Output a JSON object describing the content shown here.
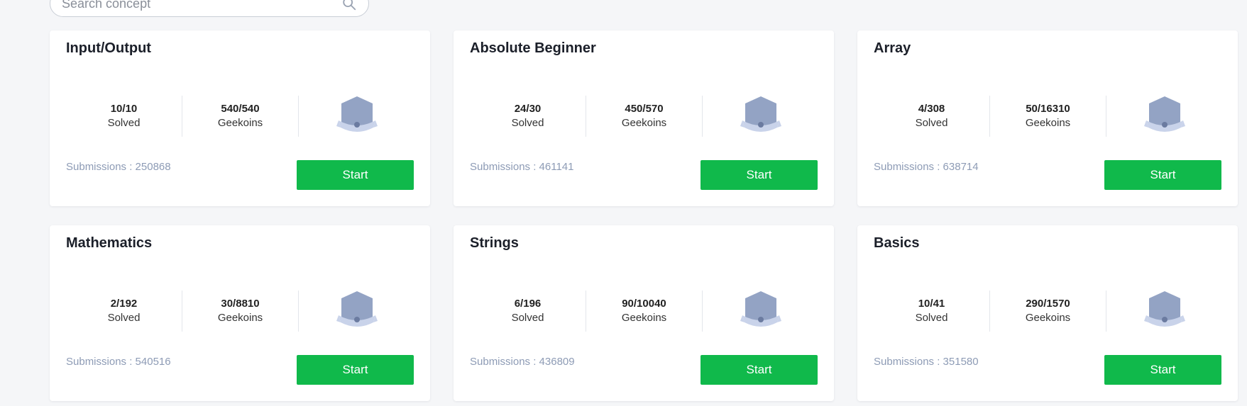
{
  "search": {
    "placeholder": "Search concept",
    "value": ""
  },
  "labels": {
    "solved": "Solved",
    "geekoins": "Geekoins",
    "start": "Start",
    "submissions_prefix": "Submissions : "
  },
  "colors": {
    "start_button": "#10b94b",
    "submissions_text": "#8d9bb5",
    "badge": "#93a3c4",
    "background": "#f5f6f8"
  },
  "cards": [
    {
      "title": "Input/Output",
      "solved": "10/10",
      "geekoins": "540/540",
      "submissions": "Submissions : 250868"
    },
    {
      "title": "Absolute Beginner",
      "solved": "24/30",
      "geekoins": "450/570",
      "submissions": "Submissions : 461141"
    },
    {
      "title": "Array",
      "solved": "4/308",
      "geekoins": "50/16310",
      "submissions": "Submissions : 638714"
    },
    {
      "title": "Mathematics",
      "solved": "2/192",
      "geekoins": "30/8810",
      "submissions": "Submissions : 540516"
    },
    {
      "title": "Strings",
      "solved": "6/196",
      "geekoins": "90/10040",
      "submissions": "Submissions : 436809"
    },
    {
      "title": "Basics",
      "solved": "10/41",
      "geekoins": "290/1570",
      "submissions": "Submissions : 351580"
    }
  ]
}
